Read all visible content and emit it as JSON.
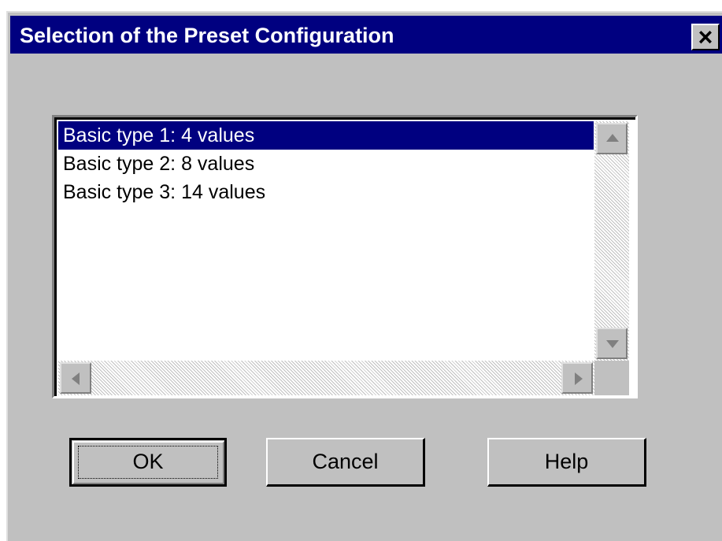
{
  "window": {
    "title": "Selection of the Preset Configuration",
    "close_glyph": "✕"
  },
  "list": {
    "items": [
      {
        "label": "Basic type 1: 4 values",
        "selected": true
      },
      {
        "label": "Basic type 2: 8 values",
        "selected": false
      },
      {
        "label": "Basic type 3: 14 values",
        "selected": false
      }
    ]
  },
  "buttons": {
    "ok": "OK",
    "cancel": "Cancel",
    "help": "Help"
  },
  "colors": {
    "title_bar": "#000080",
    "selection": "#000080",
    "face": "#c0c0c0"
  },
  "icons": [
    "close-icon",
    "scroll-up-icon",
    "scroll-down-icon",
    "scroll-left-icon",
    "scroll-right-icon"
  ]
}
